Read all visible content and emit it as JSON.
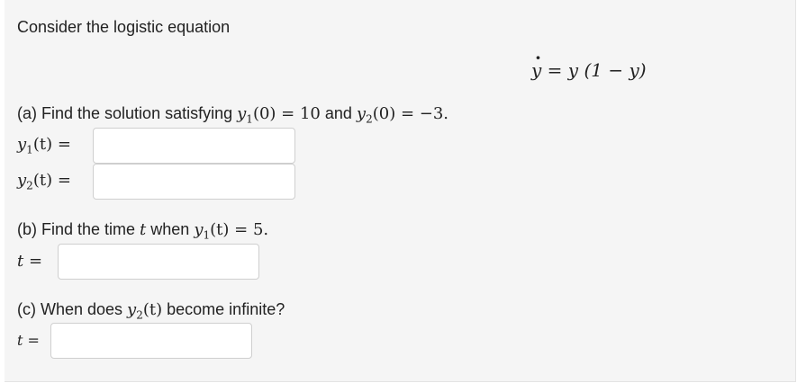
{
  "intro": "Consider the logistic equation",
  "equation": {
    "lhs": "y",
    "eq": " = ",
    "rhs": "y (1 − y)"
  },
  "part_a": {
    "prompt_prefix": "(a) Find the solution satisfying ",
    "cond1": "y",
    "cond1_sub": "1",
    "cond1_rest": "(0) = 10",
    "mid": " and ",
    "cond2": "y",
    "cond2_sub": "2",
    "cond2_rest": "(0) = −3.",
    "y1_label": "y",
    "y1_sub": "1",
    "y1_rest": "(t) =",
    "y2_label": "y",
    "y2_sub": "2",
    "y2_rest": "(t) =",
    "y1_value": "",
    "y2_value": ""
  },
  "part_b": {
    "prompt_prefix": "(b) Find the time ",
    "t": "t",
    "mid": " when ",
    "cond": "y",
    "cond_sub": "1",
    "cond_rest": "(t) = 5.",
    "t_label": "t =",
    "t_value": ""
  },
  "part_c": {
    "prompt_prefix": "(c) When does ",
    "var": "y",
    "var_sub": "2",
    "var_rest": "(t)",
    "prompt_suffix": " become infinite?",
    "t_label": "t =",
    "t_value": ""
  }
}
